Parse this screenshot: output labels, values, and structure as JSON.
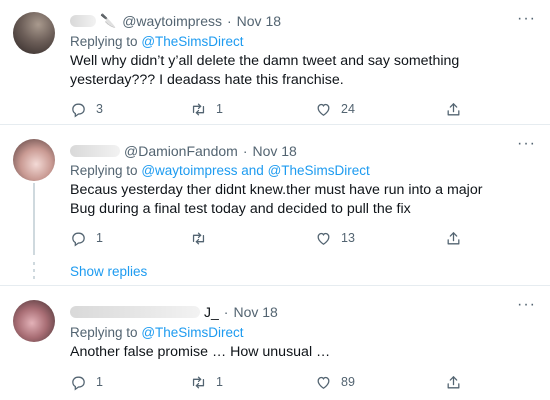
{
  "tweets": [
    {
      "handle": "@waytoimpress",
      "separator": "·",
      "time": "Nov 18",
      "replying_prefix": "Replying to",
      "mentions": "@TheSimsDirect",
      "text": "Well why didn’t y’all delete the damn tweet and say something yesterday??? I deadass hate this franchise.",
      "reply_count": "3",
      "retweet_count": "1",
      "like_count": "24"
    },
    {
      "handle": "@DamionFandom",
      "separator": "·",
      "time": "Nov 18",
      "replying_prefix": "Replying to",
      "mentions": "@waytoimpress and @TheSimsDirect",
      "text": "Becaus yesterday ther didnt knew.ther must have run into a major Bug during a final test today and decided to pull the fix",
      "reply_count": "1",
      "retweet_count": "",
      "like_count": "13"
    },
    {
      "handle": "J_",
      "separator": "·",
      "time": "Nov 18",
      "replying_prefix": "Replying to",
      "mentions": "@TheSimsDirect",
      "text": "Another false promise … How unusual …",
      "reply_count": "1",
      "retweet_count": "1",
      "like_count": "89"
    }
  ],
  "show_replies": "Show replies",
  "more_glyph": "···",
  "icons": {
    "reply": "reply-icon",
    "retweet": "retweet-icon",
    "like": "heart-icon",
    "share": "share-icon",
    "more": "more-icon"
  },
  "colors": {
    "link": "#1d9bf0",
    "secondary": "#536471",
    "text": "#0f1419"
  }
}
